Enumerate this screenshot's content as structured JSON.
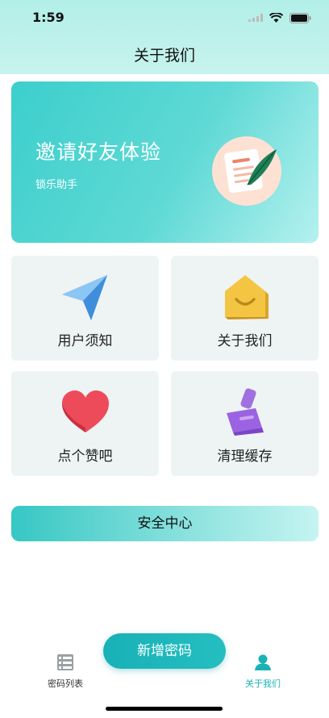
{
  "status": {
    "time": "1:59"
  },
  "nav": {
    "title": "关于我们"
  },
  "banner": {
    "title": "邀请好友体验",
    "subtitle": "锁乐助手"
  },
  "grid": [
    {
      "label": "用户须知",
      "icon": "paper-plane-icon"
    },
    {
      "label": "关于我们",
      "icon": "smile-envelope-icon"
    },
    {
      "label": "点个赞吧",
      "icon": "heart-icon"
    },
    {
      "label": "清理缓存",
      "icon": "brush-icon"
    }
  ],
  "security": {
    "label": "安全中心"
  },
  "fab": {
    "label": "新增密码"
  },
  "tabs": [
    {
      "label": "密码列表",
      "icon": "list-icon",
      "active": false
    },
    {
      "label": "关于我们",
      "icon": "user-icon",
      "active": true
    }
  ],
  "colors": {
    "accent": "#1fb8bb",
    "active_tab": "#19b3b3",
    "inactive_tab": "#333333"
  }
}
